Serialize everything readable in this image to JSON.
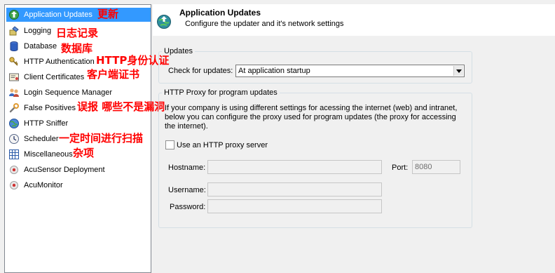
{
  "sidebar": {
    "items": [
      {
        "label": "Application Updates",
        "note": "更新",
        "icon": "globe-update-icon",
        "selected": true
      },
      {
        "label": "Logging",
        "note": "日志记录",
        "icon": "logging-icon"
      },
      {
        "label": "Database",
        "note": "数据库",
        "icon": "database-icon"
      },
      {
        "label": "HTTP Authentication",
        "note": "HTTP身份认证",
        "icon": "http-auth-icon"
      },
      {
        "label": "Client Certificates",
        "note": "客户端证书",
        "icon": "certificate-icon"
      },
      {
        "label": "Login Sequence Manager",
        "icon": "login-sequence-icon"
      },
      {
        "label": "False Positives",
        "note": "误报 哪些不是漏洞",
        "icon": "wrench-icon"
      },
      {
        "label": "HTTP Sniffer",
        "icon": "globe-sniffer-icon"
      },
      {
        "label": "Scheduler",
        "note": "一定时间进行扫描",
        "icon": "clock-icon"
      },
      {
        "label": "Miscellaneous",
        "note": "杂项",
        "icon": "grid-icon"
      },
      {
        "label": "AcuSensor Deployment",
        "icon": "acusensor-icon"
      },
      {
        "label": "AcuMonitor",
        "icon": "acumonitor-icon"
      }
    ]
  },
  "header": {
    "title": "Application Updates",
    "subtitle": "Configure the updater and it's network settings",
    "icon": "globe-update-icon"
  },
  "updates_group": {
    "title": "Updates",
    "check_label": "Check for updates:",
    "check_value": "At application startup"
  },
  "proxy_group": {
    "title": "HTTP Proxy for program updates",
    "description": "If your company is using different settings for acessing the internet (web) and intranet, below you can configure the proxy used for program updates (the proxy for accessing the internet).",
    "use_proxy_label": "Use an HTTP proxy server",
    "use_proxy_checked": false,
    "hostname_label": "Hostname:",
    "hostname_value": "",
    "port_label": "Port:",
    "port_value": "8080",
    "username_label": "Username:",
    "username_value": "",
    "password_label": "Password:",
    "password_value": ""
  },
  "colors": {
    "selection": "#3399ff",
    "annotation": "#ff0000",
    "panel_bg": "#f0f0f0"
  }
}
